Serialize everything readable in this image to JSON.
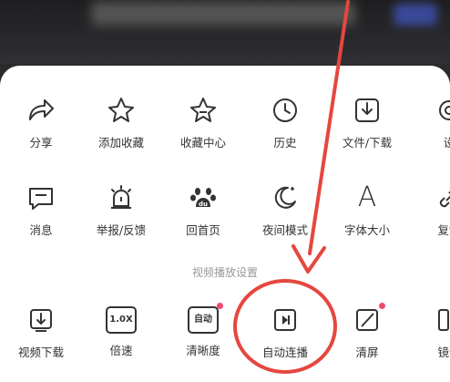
{
  "row1": [
    {
      "key": "share",
      "label": "分享",
      "icon": "share-icon"
    },
    {
      "key": "add_fav",
      "label": "添加收藏",
      "icon": "star-icon"
    },
    {
      "key": "fav_center",
      "label": "收藏中心",
      "icon": "star-badge-icon"
    },
    {
      "key": "history",
      "label": "历史",
      "icon": "clock-icon"
    },
    {
      "key": "files",
      "label": "文件/下载",
      "icon": "download-box-icon"
    },
    {
      "key": "settings",
      "label": "设",
      "icon": "gear-icon"
    }
  ],
  "row2": [
    {
      "key": "message",
      "label": "消息",
      "icon": "message-icon"
    },
    {
      "key": "report",
      "label": "举报/反馈",
      "icon": "alarm-icon"
    },
    {
      "key": "home",
      "label": "回首页",
      "icon": "paw-icon"
    },
    {
      "key": "night",
      "label": "夜间模式",
      "icon": "moon-icon"
    },
    {
      "key": "font",
      "label": "字体大小",
      "icon": "font-icon",
      "glyph": "A"
    },
    {
      "key": "copy",
      "label": "复制",
      "icon": "link-icon"
    }
  ],
  "section_title": "视频播放设置",
  "row3": [
    {
      "key": "video_dl",
      "label": "视频下载",
      "icon": "video-download-icon"
    },
    {
      "key": "speed",
      "label": "倍速",
      "icon": "speed-icon",
      "glyph": "1.0X"
    },
    {
      "key": "quality",
      "label": "清晰度",
      "icon": "quality-icon",
      "glyph": "自动"
    },
    {
      "key": "autoplay",
      "label": "自动连播",
      "icon": "play-next-icon"
    },
    {
      "key": "clear",
      "label": "清屏",
      "icon": "clear-screen-icon"
    },
    {
      "key": "mirror",
      "label": "镜像",
      "icon": "mirror-icon"
    }
  ],
  "colors": {
    "accent_red": "#e5473f",
    "badge": "#f04a6c",
    "icon_dark": "#333333"
  }
}
